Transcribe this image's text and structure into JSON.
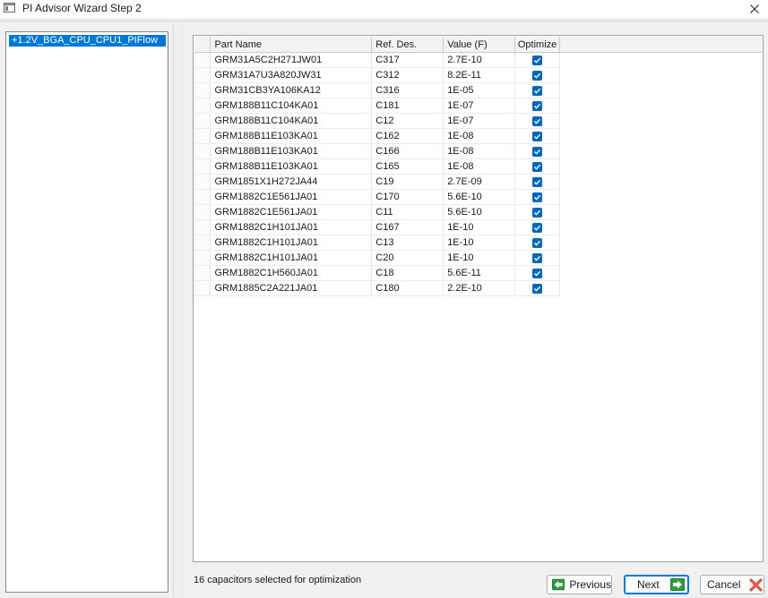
{
  "window": {
    "title": "PI Advisor Wizard Step 2"
  },
  "tree": {
    "items": [
      {
        "label": "+1.2V_BGA_CPU_CPU1_PIFlow",
        "selected": true
      }
    ]
  },
  "grid": {
    "columns": [
      "Part Name",
      "Ref. Des.",
      "Value (F)",
      "Optimize"
    ],
    "rows": [
      {
        "part_name": "GRM31A5C2H271JW01",
        "ref_des": "C317",
        "value": "2.7E-10",
        "optimize": true
      },
      {
        "part_name": "GRM31A7U3A820JW31",
        "ref_des": "C312",
        "value": "8.2E-11",
        "optimize": true
      },
      {
        "part_name": "GRM31CB3YA106KA12",
        "ref_des": "C316",
        "value": "1E-05",
        "optimize": true
      },
      {
        "part_name": "GRM188B11C104KA01",
        "ref_des": "C181",
        "value": "1E-07",
        "optimize": true
      },
      {
        "part_name": "GRM188B11C104KA01",
        "ref_des": "C12",
        "value": "1E-07",
        "optimize": true
      },
      {
        "part_name": "GRM188B11E103KA01",
        "ref_des": "C162",
        "value": "1E-08",
        "optimize": true
      },
      {
        "part_name": "GRM188B11E103KA01",
        "ref_des": "C166",
        "value": "1E-08",
        "optimize": true
      },
      {
        "part_name": "GRM188B11E103KA01",
        "ref_des": "C165",
        "value": "1E-08",
        "optimize": true
      },
      {
        "part_name": "GRM1851X1H272JA44",
        "ref_des": "C19",
        "value": "2.7E-09",
        "optimize": true
      },
      {
        "part_name": "GRM1882C1E561JA01",
        "ref_des": "C170",
        "value": "5.6E-10",
        "optimize": true
      },
      {
        "part_name": "GRM1882C1E561JA01",
        "ref_des": "C11",
        "value": "5.6E-10",
        "optimize": true
      },
      {
        "part_name": "GRM1882C1H101JA01",
        "ref_des": "C167",
        "value": "1E-10",
        "optimize": true
      },
      {
        "part_name": "GRM1882C1H101JA01",
        "ref_des": "C13",
        "value": "1E-10",
        "optimize": true
      },
      {
        "part_name": "GRM1882C1H101JA01",
        "ref_des": "C20",
        "value": "1E-10",
        "optimize": true
      },
      {
        "part_name": "GRM1882C1H560JA01",
        "ref_des": "C18",
        "value": "5.6E-11",
        "optimize": true
      },
      {
        "part_name": "GRM1885C2A221JA01",
        "ref_des": "C180",
        "value": "2.2E-10",
        "optimize": true
      }
    ]
  },
  "status": {
    "text": "16 capacitors selected for optimization"
  },
  "buttons": {
    "previous": {
      "label": "Previous",
      "icon": "arrow-left-icon"
    },
    "next": {
      "label": "Next",
      "icon": "arrow-right-icon"
    },
    "cancel": {
      "label": "Cancel",
      "icon": "red-x-icon"
    }
  },
  "colors": {
    "selection": "#0078d7",
    "checkbox": "#0067c0",
    "arrow_green": "#2e9d3c",
    "cancel_red": "#d9302c"
  }
}
